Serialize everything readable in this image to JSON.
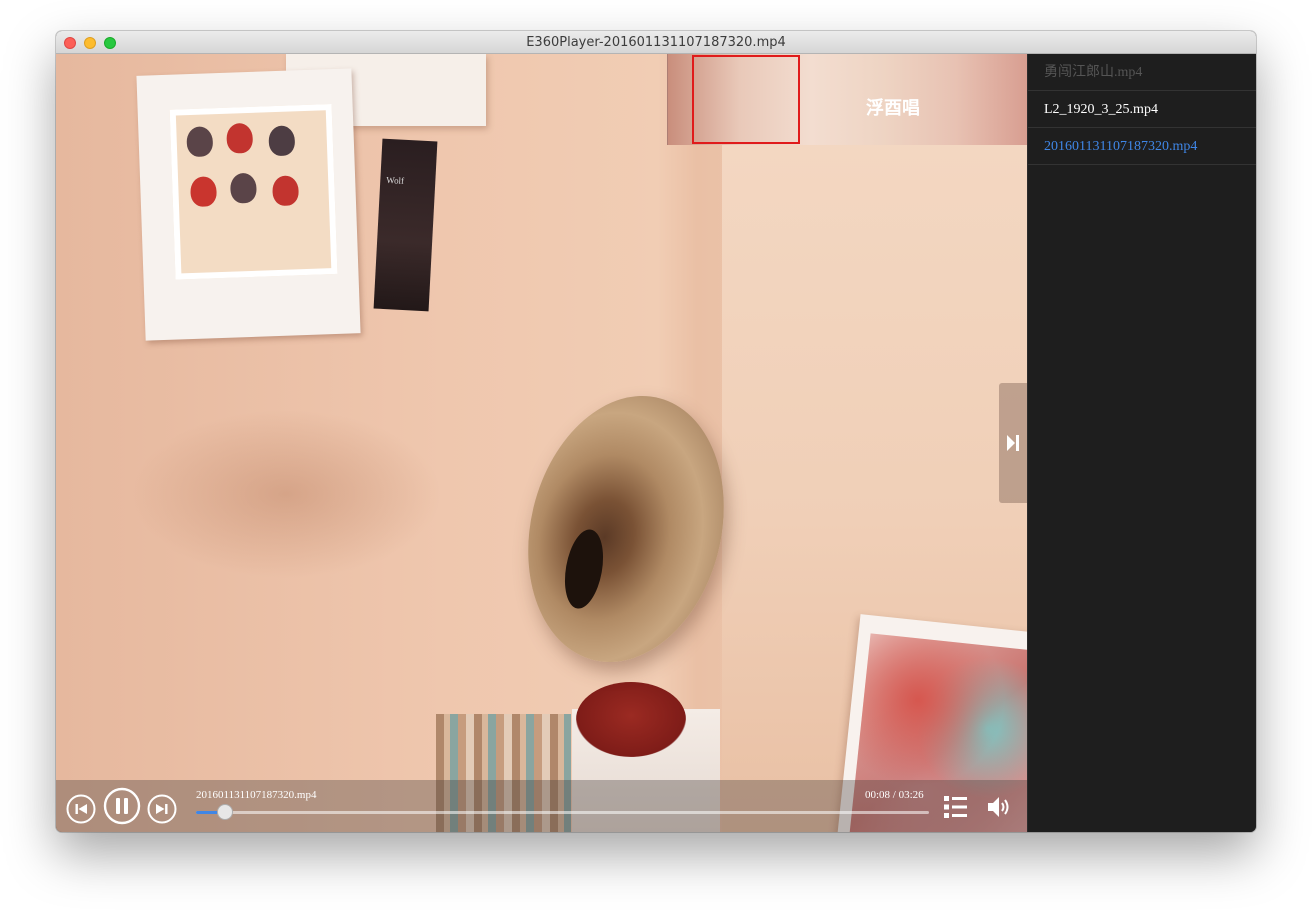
{
  "window": {
    "title": "E360Player-201601131107187320.mp4"
  },
  "minimap": {
    "overlay_text": "浮酉唱"
  },
  "poster": {
    "text": "Wolf"
  },
  "player": {
    "now_playing": "201601131107187320.mp4",
    "time_display": "00:08 / 03:26",
    "progress": 0.039
  },
  "playlist": {
    "items": [
      {
        "label": "勇闯江郎山.mp4",
        "state": "dimmed",
        "color": "#555555"
      },
      {
        "label": "L2_1920_3_25.mp4",
        "state": "normal",
        "color": "#ffffff"
      },
      {
        "label": "201601131107187320.mp4",
        "state": "playing",
        "color": "#3f86e6"
      }
    ]
  },
  "colors": {
    "accent": "#3f86e6",
    "minimap_viewport": "#e01b1b",
    "sidebar_bg": "#1e1e1e"
  },
  "icons": {
    "previous": "skip-previous-icon",
    "pause": "pause-icon",
    "next": "skip-next-icon",
    "playlist": "list-icon",
    "volume": "volume-icon",
    "sidebar_toggle": "collapse-right-icon"
  }
}
